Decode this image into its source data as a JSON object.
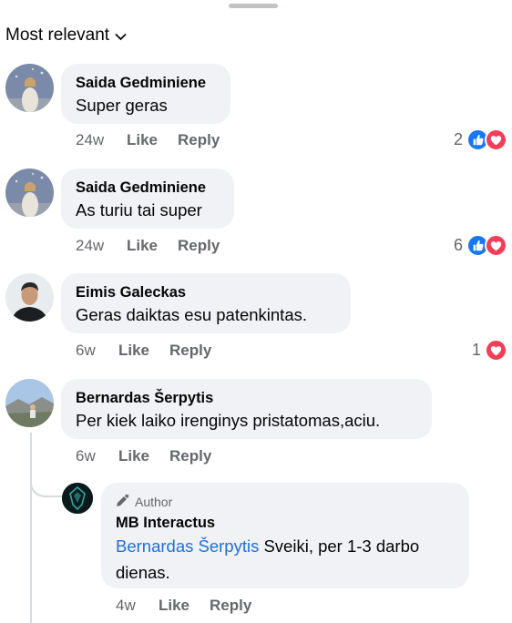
{
  "sort": {
    "label": "Most relevant"
  },
  "comments": [
    {
      "name": "Saida Gedminiene",
      "text": "Super geras",
      "time": "24w",
      "like": "Like",
      "reply": "Reply",
      "reaction_count": "2"
    },
    {
      "name": "Saida Gedminiene",
      "text": "As turiu tai super",
      "time": "24w",
      "like": "Like",
      "reply": "Reply",
      "reaction_count": "6"
    },
    {
      "name": "Eimis Galeckas",
      "text": "Geras daiktas esu patenkintas.",
      "time": "6w",
      "like": "Like",
      "reply": "Reply",
      "reaction_count": "1"
    },
    {
      "name": "Bernardas Šerpytis",
      "text": "Per kiek laiko irenginys pristatomas,aciu.",
      "time": "6w",
      "like": "Like",
      "reply": "Reply"
    }
  ],
  "reply": {
    "badge": "Author",
    "name": "MB Interactus",
    "mention": "Bernardas Šerpytis",
    "text_after_mention": " Sveiki, per 1-3 darbo",
    "text_line2": "dienas.",
    "time": "4w",
    "like": "Like",
    "reply": "Reply"
  },
  "colors": {
    "like": "#1877f2",
    "love": "#f33e58",
    "link": "#216fdb",
    "bubble": "#f0f2f5"
  }
}
